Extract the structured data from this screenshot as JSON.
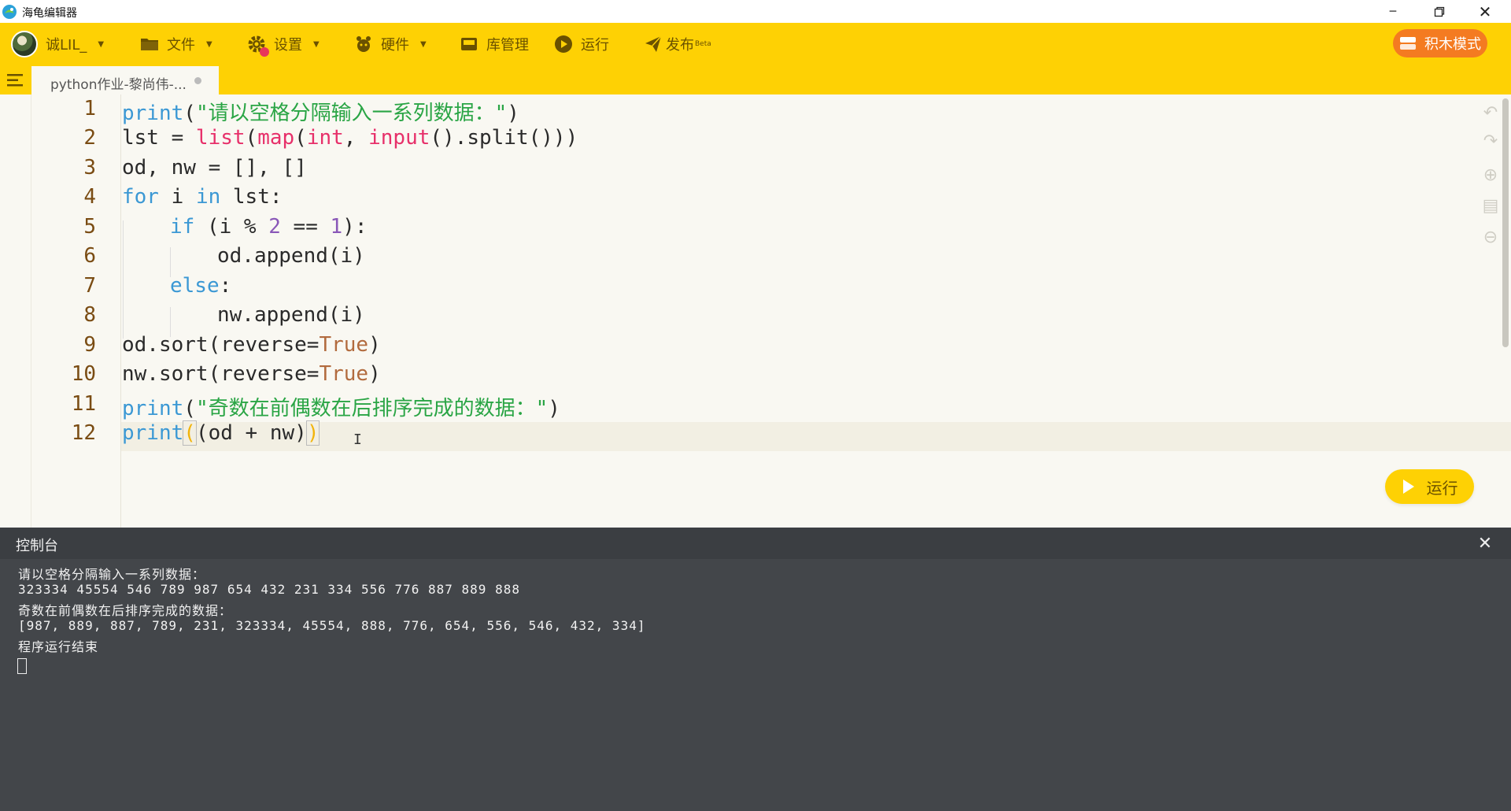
{
  "window": {
    "title": "海龟编辑器",
    "controls": [
      "minimize-icon",
      "restore-icon",
      "close-icon"
    ]
  },
  "toolbar": {
    "user": "诚LIL_",
    "items": [
      {
        "label": "文件",
        "icon": "folder-icon"
      },
      {
        "label": "设置",
        "icon": "gear-icon"
      },
      {
        "label": "硬件",
        "icon": "hardware-icon"
      },
      {
        "label": "库管理",
        "icon": "library-icon"
      },
      {
        "label": "运行",
        "icon": "play-icon"
      },
      {
        "label": "发布",
        "badge": "Beta",
        "icon": "send-icon"
      }
    ],
    "block_mode": "积木模式"
  },
  "tab": {
    "label": "python作业-黎尚伟-..."
  },
  "editor": {
    "line_numbers": [
      "1",
      "2",
      "3",
      "4",
      "5",
      "6",
      "7",
      "8",
      "9",
      "10",
      "11",
      "12"
    ],
    "run_button": "运行",
    "accent": "#fed104"
  },
  "console": {
    "title": "控制台",
    "lines": [
      "请以空格分隔输入一系列数据：",
      "323334 45554 546 789 987 654 432 231 334 556 776 887 889 888",
      "奇数在前偶数在后排序完成的数据：",
      "[987, 889, 887, 789, 231, 323334, 45554, 888, 776, 654, 556, 546, 432, 334]",
      "程序运行结束"
    ]
  },
  "code_tokens": {
    "l1": [
      "print",
      "(",
      "\"请以空格分隔输入一系列数据：\"",
      ")"
    ],
    "l2": [
      "lst = ",
      "list",
      "(",
      "map",
      "(",
      "int",
      ", ",
      "input",
      "().split()))"
    ],
    "l3": [
      "od, nw = [], []"
    ],
    "l4": [
      "for",
      " i ",
      "in",
      " lst:"
    ],
    "l5": [
      "if",
      " (i % ",
      "2",
      " == ",
      "1",
      "):"
    ],
    "l6": [
      "od.append(i)"
    ],
    "l7": [
      "else",
      ":"
    ],
    "l8": [
      "nw.append(i)"
    ],
    "l9": [
      "od.sort(reverse=",
      "True",
      ")"
    ],
    "l10": [
      "nw.sort(reverse=",
      "True",
      ")"
    ],
    "l11": [
      "print",
      "(",
      "\"奇数在前偶数在后排序完成的数据：\"",
      ")"
    ],
    "l12": [
      "print",
      "(",
      "(od + nw)",
      ")"
    ]
  }
}
